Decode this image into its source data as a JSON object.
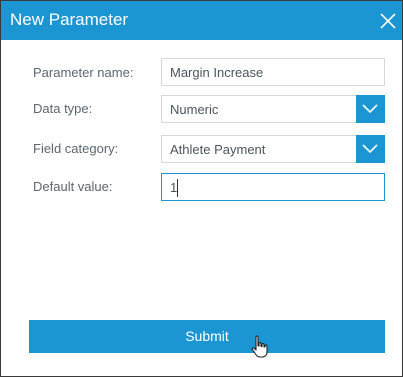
{
  "dialog": {
    "title": "New Parameter",
    "close_icon": "close-icon"
  },
  "fields": {
    "parameter_name": {
      "label": "Parameter name:",
      "value": "Margin Increase"
    },
    "data_type": {
      "label": "Data type:",
      "value": "Numeric",
      "icon": "chevron-down-icon"
    },
    "field_category": {
      "label": "Field category:",
      "value": "Athlete Payment",
      "icon": "chevron-down-icon"
    },
    "default_value": {
      "label": "Default value:",
      "value": "1"
    }
  },
  "submit": {
    "label": "Submit"
  },
  "colors": {
    "accent": "#1b96d3",
    "label": "#5b6670",
    "border": "#d4d8db"
  },
  "cursor": {
    "icon": "hand-pointer-icon"
  }
}
